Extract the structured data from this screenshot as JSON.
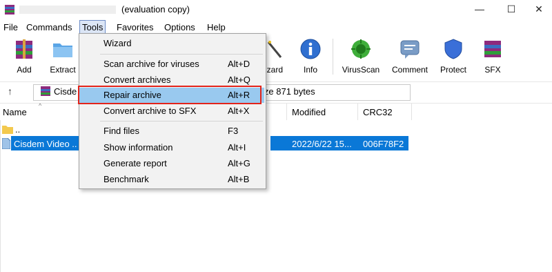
{
  "window": {
    "title": "(evaluation copy)",
    "minimize_glyph": "—",
    "maximize_glyph": "☐",
    "close_glyph": "✕"
  },
  "menubar": [
    "File",
    "Commands",
    "Tools",
    "Favorites",
    "Options",
    "Help"
  ],
  "toolbar": {
    "left": [
      {
        "label": "Add",
        "icon": "add-archive-icon"
      },
      {
        "label": "Extract",
        "icon": "extract-icon"
      }
    ],
    "right": [
      {
        "label": "izard",
        "icon": "wizard-icon"
      },
      {
        "label": "Info",
        "icon": "info-icon"
      },
      {
        "label": "VirusScan",
        "icon": "virusscan-icon"
      },
      {
        "label": "Comment",
        "icon": "comment-icon"
      },
      {
        "label": "Protect",
        "icon": "protect-icon"
      },
      {
        "label": "SFX",
        "icon": "sfx-icon"
      }
    ]
  },
  "address": {
    "up_glyph": "↑",
    "name": "Cisde",
    "size_text": "ize 871 bytes"
  },
  "columns": {
    "name": "Name",
    "modified": "Modified",
    "crc": "CRC32",
    "sort_glyph": "^"
  },
  "files": [
    {
      "name": "..",
      "modified": "",
      "crc": ""
    },
    {
      "name": "Cisdem Video ..",
      "modified": "2022/6/22 15...",
      "crc": "006F78F2"
    }
  ],
  "tools_menu": {
    "wizard": {
      "label": "Wizard",
      "shortcut": ""
    },
    "scan": {
      "label": "Scan archive for viruses",
      "shortcut": "Alt+D"
    },
    "convert": {
      "label": "Convert archives",
      "shortcut": "Alt+Q"
    },
    "repair": {
      "label": "Repair archive",
      "shortcut": "Alt+R"
    },
    "sfx": {
      "label": "Convert archive to SFX",
      "shortcut": "Alt+X"
    },
    "find": {
      "label": "Find files",
      "shortcut": "F3"
    },
    "info": {
      "label": "Show information",
      "shortcut": "Alt+I"
    },
    "report": {
      "label": "Generate report",
      "shortcut": "Alt+G"
    },
    "bench": {
      "label": "Benchmark",
      "shortcut": "Alt+B"
    }
  },
  "colors": {
    "selection": "#0a78d7",
    "menu_highlight": "#99c9ef",
    "annotation_red": "#e2231a"
  }
}
